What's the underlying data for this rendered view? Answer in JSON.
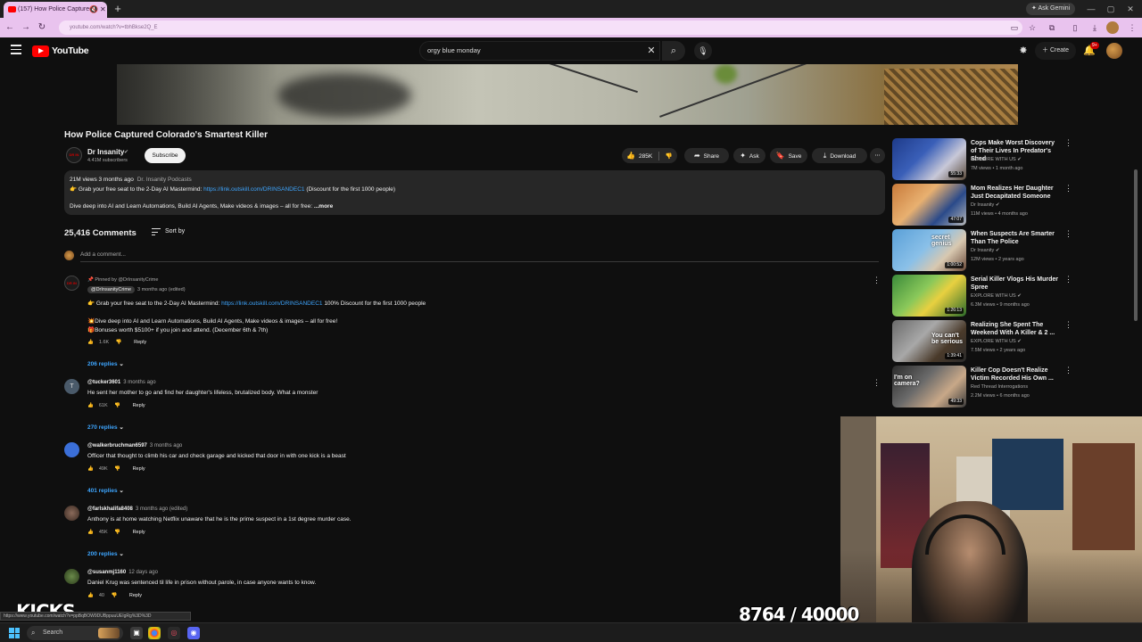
{
  "browser": {
    "tab_title": "(157) How Police Captured",
    "url": "youtube.com/watch?v=tbhBkse2Q_E",
    "ask_gemini": "Ask Gemini"
  },
  "header": {
    "logo": "YouTube",
    "search_query": "orgy blue monday",
    "create_label": "Create",
    "notif_count": "9+"
  },
  "video": {
    "title": "How Police Captured Colorado's Smartest Killer",
    "channel": "Dr Insanity",
    "channel_avatar_text": "DR IN",
    "subscribers": "4.41M subscribers",
    "subscribe_label": "Subscribe",
    "likes": "285K",
    "share_label": "Share",
    "ask_label": "Ask",
    "save_label": "Save",
    "download_label": "Download"
  },
  "description": {
    "meta": "21M views  3 months ago",
    "tag": "Dr. Insanity Podcasts",
    "line1_prefix": "👉 Grab your free seat to the 2-Day AI Mastermind:",
    "line1_link": "https://link.outskill.com/DRINSANDEC1",
    "line1_suffix": "(Discount for the first 1000 people)",
    "line2": "Dive deep into AI and Learn Automations, Build AI Agents, Make videos & images – all for free:",
    "more": "...more"
  },
  "comments_header": {
    "count": "25,416 Comments",
    "sort_label": "Sort by",
    "add_placeholder": "Add a comment..."
  },
  "pinned": {
    "note": "Pinned by @DrInsanityCrime",
    "author": "@DrInsanityCrime",
    "time": "3 months ago (edited)",
    "line1_prefix": "👉 Grab your free seat to the 2-Day AI Mastermind:",
    "line1_link": "https://link.outskill.com/DRINSANDEC1",
    "line1_suffix": "100% Discount for the first 1000 people",
    "line2": "💥Dive deep into AI and Learn Automations, Build AI Agents, Make videos & images – all for free!",
    "line3": "🎁Bonuses worth $5100+ if you join and attend. (December 6th & 7th)",
    "likes": "1.6K",
    "reply": "Reply",
    "replies": "206 replies"
  },
  "comments": [
    {
      "author": "@tucker3601",
      "time": "3 months ago",
      "text": "He sent her mother to go and find her daughter's lifeless, brutalized body. What a monster",
      "likes": "61K",
      "reply": "Reply",
      "replies": "270 replies",
      "avatar_letter": "T"
    },
    {
      "author": "@walkerbruchman6597",
      "time": "3 months ago",
      "text": "Officer that thought to climb his car and check garage and kicked that door in with one kick is a beast",
      "likes": "49K",
      "reply": "Reply",
      "replies": "401 replies"
    },
    {
      "author": "@farlskhalifa8408",
      "time": "3 months ago (edited)",
      "text": "Anthony is at home watching Netflix unaware that he is the prime suspect in a 1st degree murder case.",
      "likes": "45K",
      "reply": "Reply",
      "replies": "200 replies"
    },
    {
      "author": "@susanmj1160",
      "time": "12 days ago",
      "text": "Daniel Krug was sentenced til life in prison without parole, in case anyone wants to know.",
      "likes": "40",
      "reply": "Reply"
    }
  ],
  "recommendations": [
    {
      "title": "Cops Make Worst Discovery of Their Lives In Predator's Shed",
      "channel": "EXPLORE WITH US",
      "views": "7M views • 1 month ago",
      "duration": "55:33"
    },
    {
      "title": "Mom Realizes Her Daughter Just Decapitated Someone",
      "channel": "Dr Insanity",
      "views": "11M views • 4 months ago",
      "duration": "47:07"
    },
    {
      "title": "When Suspects Are Smarter Than The Police",
      "channel": "Dr Insanity",
      "views": "12M views • 2 years ago",
      "duration": "1:00:52",
      "thumb_text": "secret genius"
    },
    {
      "title": "Serial Killer Vlogs His Murder Spree",
      "channel": "EXPLORE WITH US",
      "views": "6.3M views • 9 months ago",
      "duration": "1:26:13"
    },
    {
      "title": "Realizing She Spent The Weekend With A Killer & 2 ...",
      "channel": "EXPLORE WITH US",
      "views": "7.5M views • 2 years ago",
      "duration": "1:39:41",
      "thumb_text": "You can't be serious"
    },
    {
      "title": "Killer Cop Doesn't Realize Victim Recorded His Own ...",
      "channel": "Red Thread Interrogations",
      "views": "2.2M views • 6 months ago",
      "duration": "49:33",
      "thumb_text": "I'm on camera?"
    }
  ],
  "overlay": {
    "logo_text": "KICKS",
    "counter": "8764 / 40000",
    "status_url": "https://www.youtube.com/watch?v=ppBqBOW9DUBppuuUEIgRg%3D%3D"
  },
  "taskbar": {
    "search_label": "Search"
  }
}
